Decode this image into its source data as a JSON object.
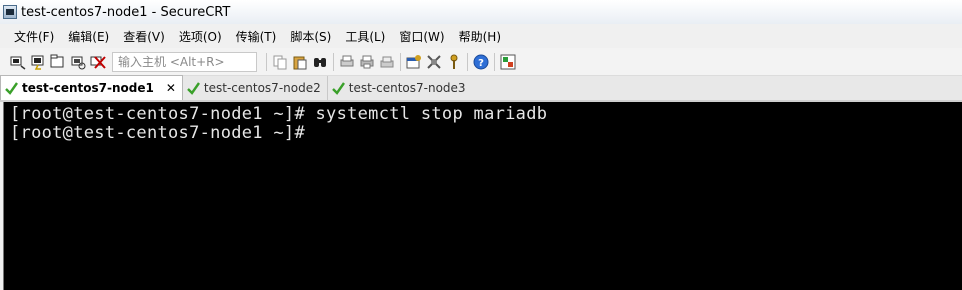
{
  "window": {
    "title": "test-centos7-node1 - SecureCRT"
  },
  "menu": {
    "items": [
      "文件(F)",
      "编辑(E)",
      "查看(V)",
      "选项(O)",
      "传输(T)",
      "脚本(S)",
      "工具(L)",
      "窗口(W)",
      "帮助(H)"
    ]
  },
  "toolbar": {
    "host_placeholder": "输入主机 <Alt+R>",
    "buttons_left": [
      "connect-icon",
      "quick-connect-icon",
      "connect-in-tab-icon",
      "reconnect-icon",
      "disconnect-icon"
    ],
    "buttons_right": [
      "copy-icon",
      "paste-icon",
      "find-icon",
      "print-icon",
      "print-selection-icon",
      "print-setup-icon",
      "session-options-icon",
      "global-options-icon",
      "keymap-icon",
      "help-icon",
      "sftp-icon"
    ]
  },
  "tabs": [
    {
      "label": "test-centos7-node1",
      "active": true
    },
    {
      "label": "test-centos7-node2",
      "active": false
    },
    {
      "label": "test-centos7-node3",
      "active": false
    }
  ],
  "terminal": {
    "lines": [
      "[root@test-centos7-node1 ~]# systemctl stop mariadb",
      "[root@test-centos7-node1 ~]#"
    ]
  },
  "colors": {
    "terminal_bg": "#000000",
    "terminal_fg": "#e6e6e6",
    "check_green": "#3aa02a"
  }
}
